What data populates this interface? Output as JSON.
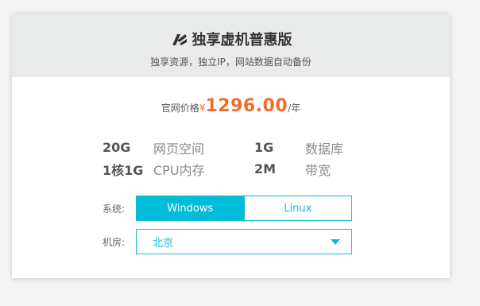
{
  "header": {
    "title": "独享虚机普惠版",
    "subtitle": "独享资源，独立IP，网站数据自动备份"
  },
  "price": {
    "label": "官网价格",
    "currency": "¥",
    "amount": "1296.00",
    "unit": "/年"
  },
  "specs": [
    {
      "value": "20G",
      "label": "网页空间",
      "value2": "1G",
      "label2": "数据库"
    },
    {
      "value": "1核1G",
      "label": "CPU内存",
      "value2": "2M",
      "label2": "带宽"
    }
  ],
  "system": {
    "label": "系统:",
    "options": [
      "Windows",
      "Linux"
    ],
    "selected": "Windows"
  },
  "room": {
    "label": "机房:",
    "value": "北京"
  },
  "colors": {
    "accent": "#00bcd9",
    "price": "#f06d2c"
  }
}
